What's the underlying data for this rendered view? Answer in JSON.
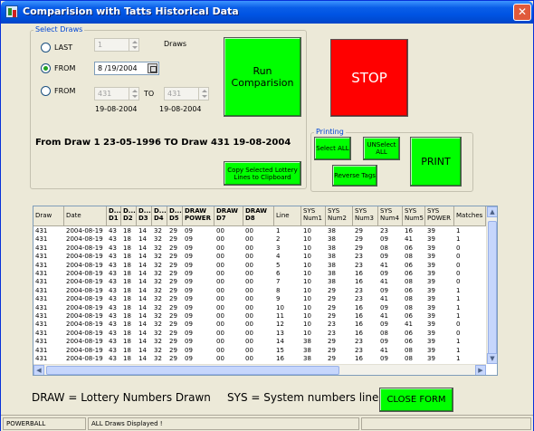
{
  "window": {
    "title": "Comparision with Tatts Historical Data",
    "close_glyph": "✕"
  },
  "select_draws": {
    "legend": "Select Draws",
    "radio_last": {
      "label": "LAST",
      "checked": false
    },
    "radio_from_date": {
      "label": "FROM",
      "checked": true
    },
    "radio_from_range": {
      "label": "FROM",
      "checked": false
    },
    "last_count": "1",
    "draws_label": "Draws",
    "from_date_value": "8 /19/2004",
    "range_from": "431",
    "range_to": "431",
    "to_label": "TO",
    "range_from_date": "19-08-2004",
    "range_to_date": "19-08-2004",
    "run_button": "Run\nComparision",
    "stop_button": "STOP",
    "copy_button": "Copy Selected Lottery\nLines to Clipboard"
  },
  "draw_range_text": "From Draw 1 23-05-1996 TO Draw 431 19-08-2004",
  "printing": {
    "legend": "Printing",
    "select_all": "Select  ALL",
    "unselect_all": "UNSelect\nALL",
    "reverse_tags": "Reverse Tags",
    "print": "PRINT"
  },
  "grid": {
    "headers": [
      "Draw No.",
      "Date",
      "D...\nD1",
      "D...\nD2",
      "D...\nD3",
      "D...\nD4",
      "D...\nD5",
      "DRAW\nPOWER",
      "DRAW\nD7",
      "DRAW\nD8",
      "Line",
      "SYS\nNum1",
      "SYS\nNum2",
      "SYS\nNum3",
      "SYS\nNum4",
      "SYS\nNum5",
      "SYS\nPOWER",
      "Matches"
    ],
    "rows": [
      [
        "431",
        "2004-08-19",
        "43",
        "18",
        "14",
        "32",
        "29",
        "09",
        "00",
        "00",
        "1",
        "10",
        "38",
        "29",
        "23",
        "16",
        "39",
        "1"
      ],
      [
        "431",
        "2004-08-19",
        "43",
        "18",
        "14",
        "32",
        "29",
        "09",
        "00",
        "00",
        "2",
        "10",
        "38",
        "29",
        "09",
        "41",
        "39",
        "1"
      ],
      [
        "431",
        "2004-08-19",
        "43",
        "18",
        "14",
        "32",
        "29",
        "09",
        "00",
        "00",
        "3",
        "10",
        "38",
        "29",
        "08",
        "06",
        "39",
        "0"
      ],
      [
        "431",
        "2004-08-19",
        "43",
        "18",
        "14",
        "32",
        "29",
        "09",
        "00",
        "00",
        "4",
        "10",
        "38",
        "23",
        "09",
        "08",
        "39",
        "0"
      ],
      [
        "431",
        "2004-08-19",
        "43",
        "18",
        "14",
        "32",
        "29",
        "09",
        "00",
        "00",
        "5",
        "10",
        "38",
        "23",
        "41",
        "06",
        "39",
        "0"
      ],
      [
        "431",
        "2004-08-19",
        "43",
        "18",
        "14",
        "32",
        "29",
        "09",
        "00",
        "00",
        "6",
        "10",
        "38",
        "16",
        "09",
        "06",
        "39",
        "0"
      ],
      [
        "431",
        "2004-08-19",
        "43",
        "18",
        "14",
        "32",
        "29",
        "09",
        "00",
        "00",
        "7",
        "10",
        "38",
        "16",
        "41",
        "08",
        "39",
        "0"
      ],
      [
        "431",
        "2004-08-19",
        "43",
        "18",
        "14",
        "32",
        "29",
        "09",
        "00",
        "00",
        "8",
        "10",
        "29",
        "23",
        "09",
        "06",
        "39",
        "1"
      ],
      [
        "431",
        "2004-08-19",
        "43",
        "18",
        "14",
        "32",
        "29",
        "09",
        "00",
        "00",
        "9",
        "10",
        "29",
        "23",
        "41",
        "08",
        "39",
        "1"
      ],
      [
        "431",
        "2004-08-19",
        "43",
        "18",
        "14",
        "32",
        "29",
        "09",
        "00",
        "00",
        "10",
        "10",
        "29",
        "16",
        "09",
        "08",
        "39",
        "1"
      ],
      [
        "431",
        "2004-08-19",
        "43",
        "18",
        "14",
        "32",
        "29",
        "09",
        "00",
        "00",
        "11",
        "10",
        "29",
        "16",
        "41",
        "06",
        "39",
        "1"
      ],
      [
        "431",
        "2004-08-19",
        "43",
        "18",
        "14",
        "32",
        "29",
        "09",
        "00",
        "00",
        "12",
        "10",
        "23",
        "16",
        "09",
        "41",
        "39",
        "0"
      ],
      [
        "431",
        "2004-08-19",
        "43",
        "18",
        "14",
        "32",
        "29",
        "09",
        "00",
        "00",
        "13",
        "10",
        "23",
        "16",
        "08",
        "06",
        "39",
        "0"
      ],
      [
        "431",
        "2004-08-19",
        "43",
        "18",
        "14",
        "32",
        "29",
        "09",
        "00",
        "00",
        "14",
        "38",
        "29",
        "23",
        "09",
        "06",
        "39",
        "1"
      ],
      [
        "431",
        "2004-08-19",
        "43",
        "18",
        "14",
        "32",
        "29",
        "09",
        "00",
        "00",
        "15",
        "38",
        "29",
        "23",
        "41",
        "08",
        "39",
        "1"
      ],
      [
        "431",
        "2004-08-19",
        "43",
        "18",
        "14",
        "32",
        "29",
        "09",
        "00",
        "00",
        "16",
        "38",
        "29",
        "16",
        "09",
        "08",
        "39",
        "1"
      ]
    ]
  },
  "legend": {
    "draw_text": "DRAW = Lottery Numbers Drawn",
    "sys_text": "SYS = System numbers line",
    "close_button": "CLOSE FORM"
  },
  "status": {
    "panel1": "POWERBALL",
    "panel2": "ALL Draws Displayed !"
  },
  "colors": {
    "green_button": "#00ff00",
    "stop_button": "#ff0000",
    "title_bar": "#0054e3"
  }
}
